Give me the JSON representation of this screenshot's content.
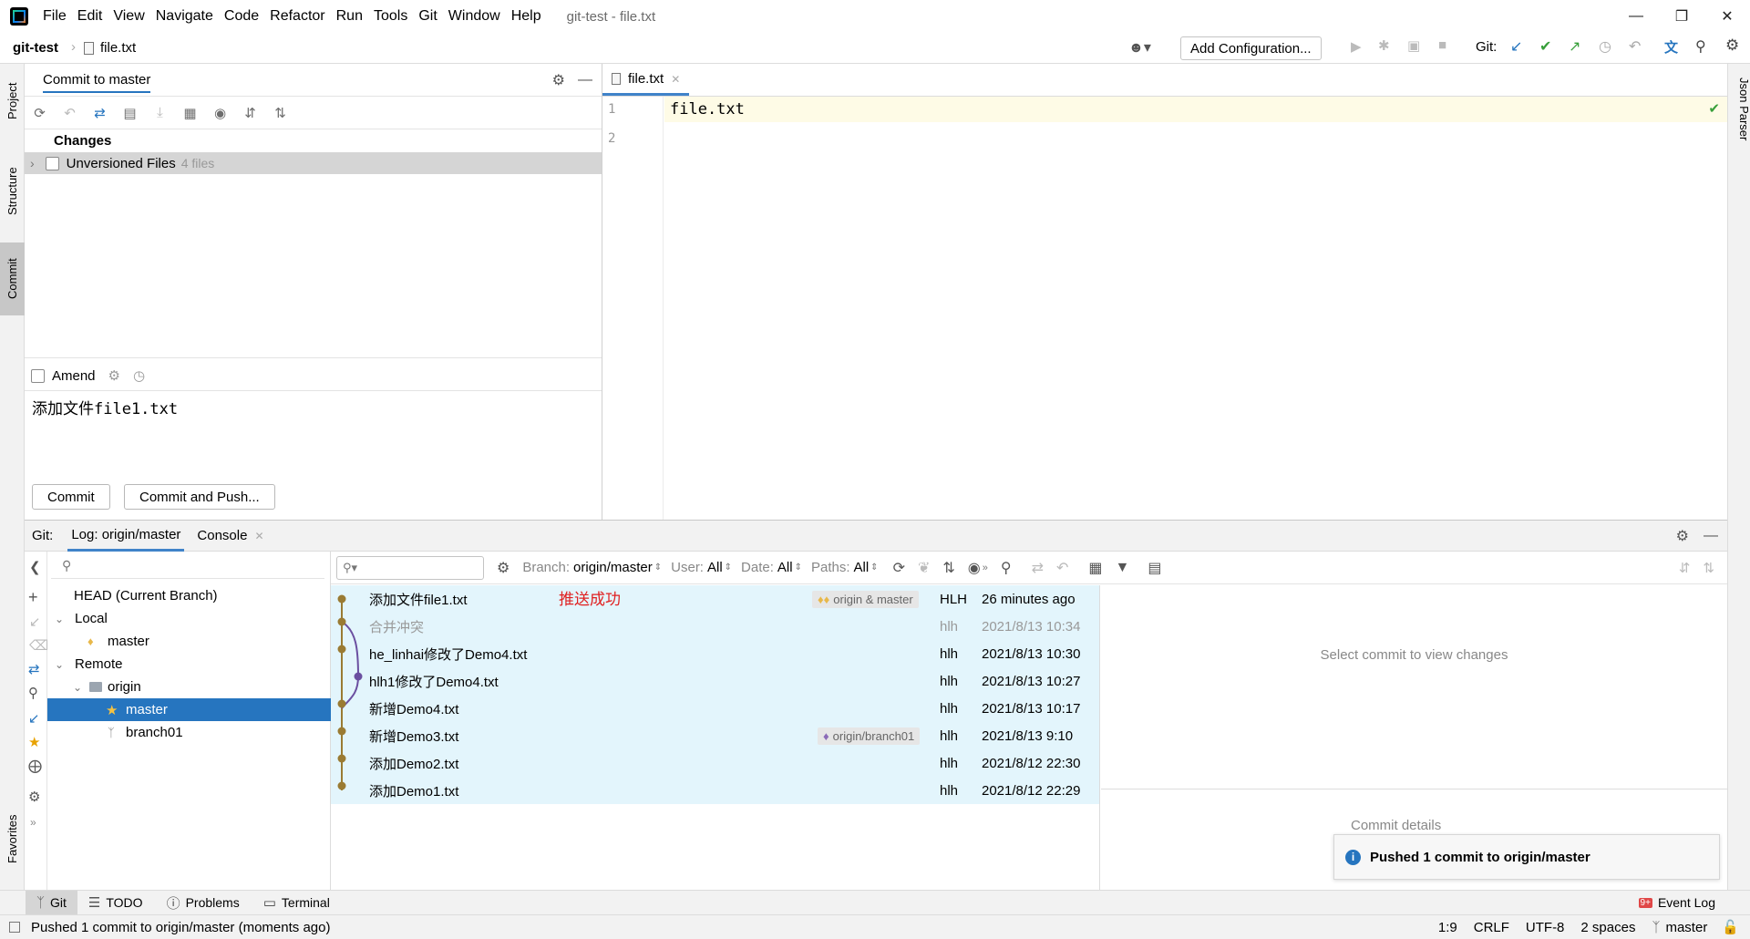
{
  "menubar": {
    "items": [
      "File",
      "Edit",
      "View",
      "Navigate",
      "Code",
      "Refactor",
      "Run",
      "Tools",
      "Git",
      "Window",
      "Help"
    ],
    "window_title": "git-test - file.txt"
  },
  "navbar": {
    "project": "git-test",
    "file": "file.txt",
    "add_config": "Add Configuration...",
    "git_label": "Git:"
  },
  "left_strip": {
    "project": "Project",
    "structure": "Structure",
    "commit": "Commit",
    "favorites": "Favorites"
  },
  "right_strip": {
    "json_parser": "Json Parser"
  },
  "commit_panel": {
    "title": "Commit to master",
    "changes_label": "Changes",
    "unversioned_label": "Unversioned Files",
    "unversioned_count": "4 files",
    "amend_label": "Amend",
    "message": "添加文件file1.txt",
    "commit_button": "Commit",
    "commit_push_button": "Commit and Push..."
  },
  "editor": {
    "tab": "file.txt",
    "lines": [
      "1",
      "2"
    ],
    "content": "file.txt"
  },
  "git_panel": {
    "git_label": "Git:",
    "log_tab": "Log: origin/master",
    "console_tab": "Console",
    "filters": {
      "branch_label": "Branch:",
      "branch_value": "origin/master",
      "user_label": "User:",
      "user_value": "All",
      "date_label": "Date:",
      "date_value": "All",
      "paths_label": "Paths:",
      "paths_value": "All"
    },
    "branch_tree": {
      "head": "HEAD (Current Branch)",
      "local": "Local",
      "local_master": "master",
      "remote": "Remote",
      "origin": "origin",
      "origin_master": "master",
      "origin_branch01": "branch01"
    },
    "annotation": "推送成功",
    "commits": [
      {
        "msg": "添加文件file1.txt",
        "tag": "origin & master",
        "author": "HLH",
        "date": "26 minutes ago"
      },
      {
        "msg": "合并冲突",
        "tag": "",
        "author": "hlh",
        "date": "2021/8/13 10:34"
      },
      {
        "msg": "he_linhai修改了Demo4.txt",
        "tag": "",
        "author": "hlh",
        "date": "2021/8/13 10:30"
      },
      {
        "msg": "hlh1修改了Demo4.txt",
        "tag": "",
        "author": "hlh",
        "date": "2021/8/13 10:27"
      },
      {
        "msg": "新增Demo4.txt",
        "tag": "",
        "author": "hlh",
        "date": "2021/8/13 10:17"
      },
      {
        "msg": "新增Demo3.txt",
        "tag": "origin/branch01",
        "author": "hlh",
        "date": "2021/8/13 9:10"
      },
      {
        "msg": "添加Demo2.txt",
        "tag": "",
        "author": "hlh",
        "date": "2021/8/12 22:30"
      },
      {
        "msg": "添加Demo1.txt",
        "tag": "",
        "author": "hlh",
        "date": "2021/8/12 22:29"
      }
    ],
    "select_commit_hint": "Select commit to view changes",
    "commit_details": "Commit details",
    "notification": "Pushed 1 commit to origin/master"
  },
  "toolwindow_bar": {
    "git": "Git",
    "todo": "TODO",
    "problems": "Problems",
    "terminal": "Terminal",
    "event_log": "Event Log",
    "event_badge": "9+"
  },
  "statusbar": {
    "message": "Pushed 1 commit to origin/master (moments ago)",
    "position": "1:9",
    "line_sep": "CRLF",
    "encoding": "UTF-8",
    "indent": "2 spaces",
    "branch": "master"
  },
  "colors": {
    "accent": "#2675bf",
    "graph": "#9a7b33",
    "graph_purple": "#6b4fa0",
    "highlight": "#e3f5fc",
    "annotation": "#e02020"
  }
}
